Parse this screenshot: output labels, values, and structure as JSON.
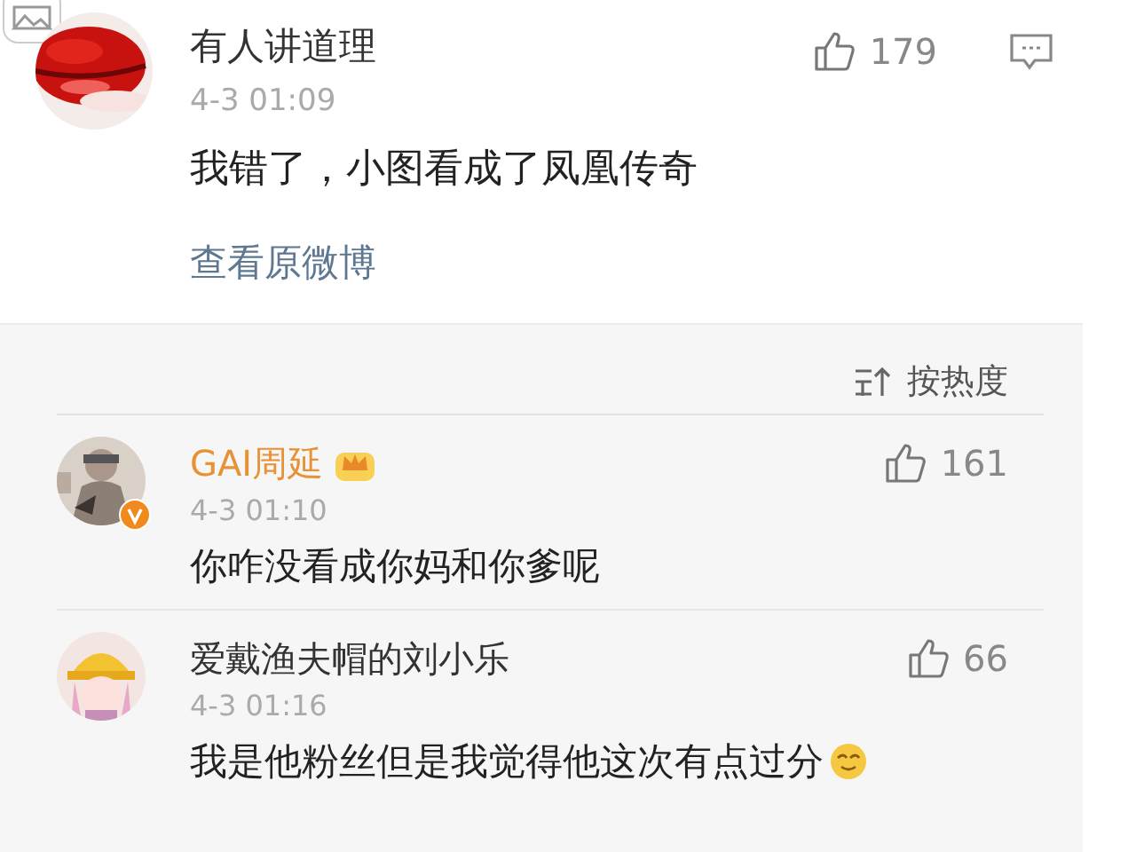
{
  "comment": {
    "name": "有人讲道理",
    "time": "4-3 01:09",
    "text": "我错了，小图看成了凤凰传奇",
    "likes": "179",
    "link": "查看原微博"
  },
  "sort": {
    "label": "按热度"
  },
  "replies": [
    {
      "name": "GAI周延",
      "vip": true,
      "verified": true,
      "time": "4-3 01:10",
      "text": "你咋没看成你妈和你爹呢",
      "likes": "161",
      "trailing_emoji": false
    },
    {
      "name": "爱戴渔夫帽的刘小乐",
      "vip": false,
      "verified": false,
      "time": "4-3 01:16",
      "text": "我是他粉丝但是我觉得他这次有点过分",
      "likes": "66",
      "trailing_emoji": true
    }
  ]
}
